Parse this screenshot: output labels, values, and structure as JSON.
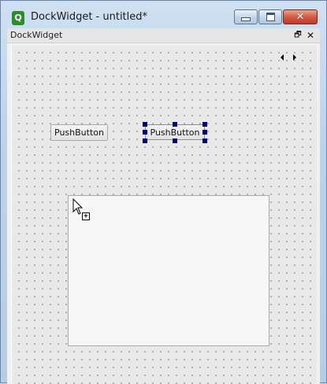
{
  "window": {
    "title": "DockWidget - untitled*",
    "app_icon_glyph": "Q",
    "icons": [
      "qt-designer-icon",
      "minimize-icon",
      "maximize-icon",
      "close-icon"
    ],
    "close_glyph": "✕"
  },
  "dock": {
    "title": "DockWidget",
    "float_glyph": "🗗",
    "close_glyph": "✕"
  },
  "form": {
    "push_buttons": [
      {
        "label": "PushButton",
        "selected": false
      },
      {
        "label": "PushButton",
        "selected": true
      }
    ],
    "list_widget": {
      "items": []
    }
  },
  "colors": {
    "selection_handle": "#000080",
    "close_button": "#c0392b"
  }
}
